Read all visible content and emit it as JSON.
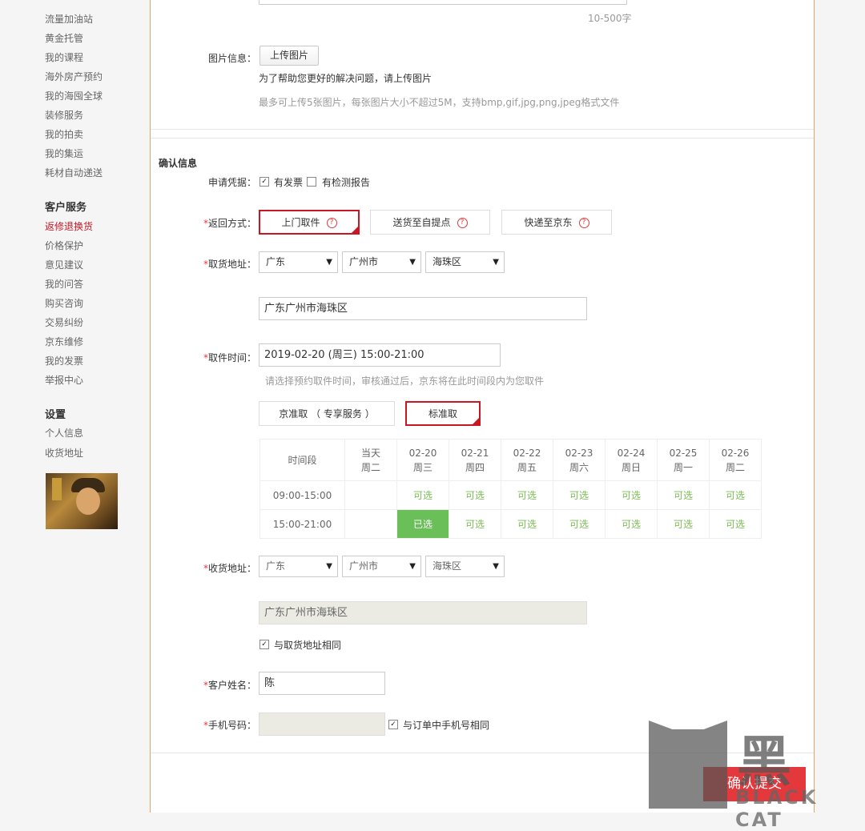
{
  "sidebar": {
    "items_top": [
      "流量加油站",
      "黄金托管",
      "我的课程",
      "海外房产预约",
      "我的海囤全球",
      "装修服务",
      "我的拍卖",
      "我的集运",
      "耗材自动递送"
    ],
    "service_title": "客户服务",
    "service_items": [
      "返修退换货",
      "价格保护",
      "意见建议",
      "我的问答",
      "购买咨询",
      "交易纠纷",
      "京东维修",
      "我的发票",
      "举报中心"
    ],
    "settings_title": "设置",
    "settings_items": [
      "个人信息",
      "收货地址"
    ]
  },
  "form": {
    "char_count": "10-500字",
    "image_label": "图片信息：",
    "upload_button": "上传图片",
    "upload_tip": "为了帮助您更好的解决问题，请上传图片",
    "upload_limit": "最多可上传5张图片，每张图片大小不超过5M，支持bmp,gif,jpg,png,jpeg格式文件",
    "confirm_title": "确认信息",
    "voucher_label": "申请凭据：",
    "voucher_invoice": "有发票",
    "voucher_report": "有检测报告",
    "return_label": "返回方式：",
    "return_options": [
      "上门取件",
      "送货至自提点",
      "快递至京东"
    ],
    "pickup_addr_label": "取货地址：",
    "province": "广东",
    "city": "广州市",
    "district": "海珠区",
    "pickup_addr_detail": "广东广州市海珠区",
    "pickup_time_label": "取件时间：",
    "pickup_time_value": "2019-02-20 (周三) 15:00-21:00",
    "pickup_time_hint": "请选择预约取件时间，审核通过后，京东将在此时间段内为您取件",
    "service_options": [
      "京准取 （ 专享服务 ）",
      "标准取"
    ],
    "receive_addr_label": "收货地址：",
    "receive_addr_detail": "广东广州市海珠区",
    "same_as_pickup": "与取货地址相同",
    "name_label": "客户姓名：",
    "name_value": "陈",
    "phone_label": "手机号码：",
    "same_phone": "与订单中手机号相同",
    "required_mark": "*",
    "submit": "确认提交"
  },
  "schedule": {
    "header_label": "时间段",
    "columns": [
      {
        "date": "当天",
        "weekday": "周二"
      },
      {
        "date": "02-20",
        "weekday": "周三"
      },
      {
        "date": "02-21",
        "weekday": "周四"
      },
      {
        "date": "02-22",
        "weekday": "周五"
      },
      {
        "date": "02-23",
        "weekday": "周六"
      },
      {
        "date": "02-24",
        "weekday": "周日"
      },
      {
        "date": "02-25",
        "weekday": "周一"
      },
      {
        "date": "02-26",
        "weekday": "周二"
      }
    ],
    "rows": [
      {
        "slot": "09:00-15:00",
        "cells": [
          "",
          "可选",
          "可选",
          "可选",
          "可选",
          "可选",
          "可选",
          "可选"
        ]
      },
      {
        "slot": "15:00-21:00",
        "cells": [
          "",
          "已选",
          "可选",
          "可选",
          "可选",
          "可选",
          "可选",
          "可选"
        ]
      }
    ]
  },
  "watermark": {
    "char": "黑",
    "brand": "BLACK CAT"
  },
  "colors": {
    "accent": "#c81623",
    "available": "#7abd54",
    "selected_cell": "#6bbf59",
    "submit": "#e4393c"
  }
}
